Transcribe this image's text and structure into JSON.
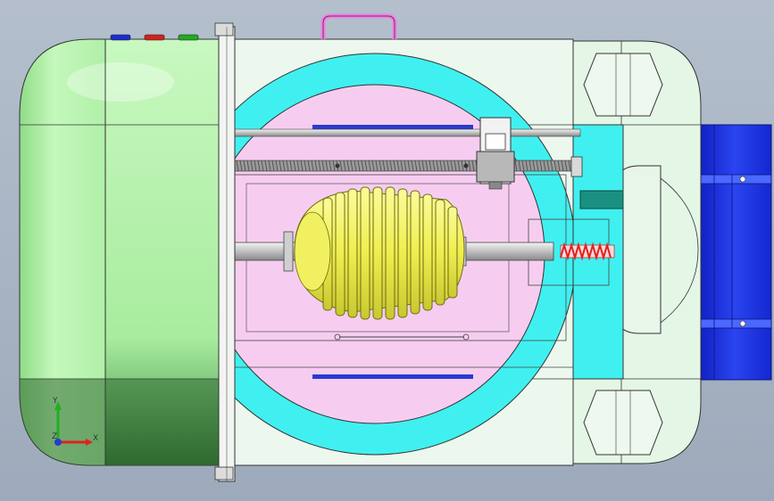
{
  "axes": {
    "y_label": "Y",
    "x_label": "X",
    "z_label": "Z"
  },
  "colors": {
    "background_top": "#b4bfcc",
    "background_bottom": "#9daabb",
    "housing_green": "#b8f5b2",
    "housing_shadow": "#3f7d3f",
    "glass": "#e6f4e8",
    "ring_cyan": "#40f0f0",
    "chamber_pink": "#f5c8f0",
    "egg_yellow": "#f0f060",
    "spring_red": "#e02020",
    "motor_blue": "#1a30e0",
    "handle_pink": "#f080e0",
    "bracket_teal": "#1a9080"
  },
  "buttons": [
    {
      "name": "blue-indicator",
      "color": "#1a2ecc"
    },
    {
      "name": "red-indicator",
      "color": "#d42020"
    },
    {
      "name": "green-indicator",
      "color": "#22aa22"
    }
  ]
}
